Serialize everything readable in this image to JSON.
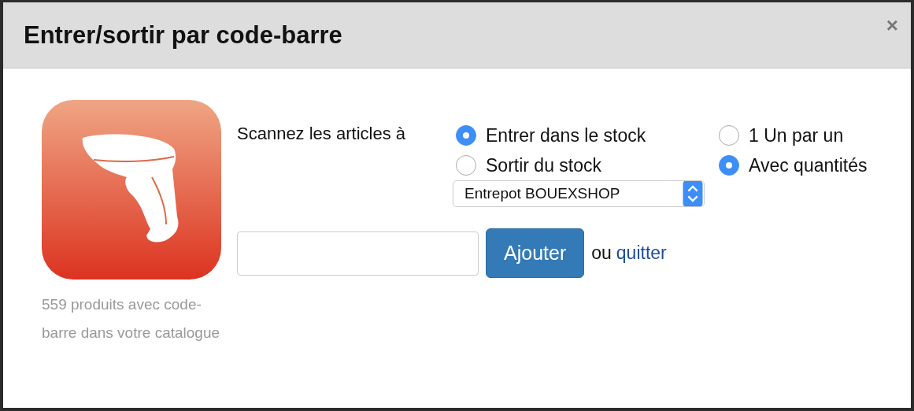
{
  "dialog": {
    "title": "Entrer/sortir par code-barre",
    "close": "×"
  },
  "info": "559 produits avec code-barre dans votre catalogue",
  "scan_label": "Scannez les articles à",
  "direction_options": [
    {
      "label": "Entrer dans le stock",
      "selected": true
    },
    {
      "label": "Sortir du stock",
      "selected": false
    }
  ],
  "warehouse_select": {
    "value": "Entrepot BOUEXSHOP"
  },
  "mode_options": [
    {
      "label": "1 Un par un",
      "selected": false
    },
    {
      "label": "Avec quantités",
      "selected": true
    }
  ],
  "add_button": "Ajouter",
  "or_text": "ou",
  "quit_link": "quitter"
}
